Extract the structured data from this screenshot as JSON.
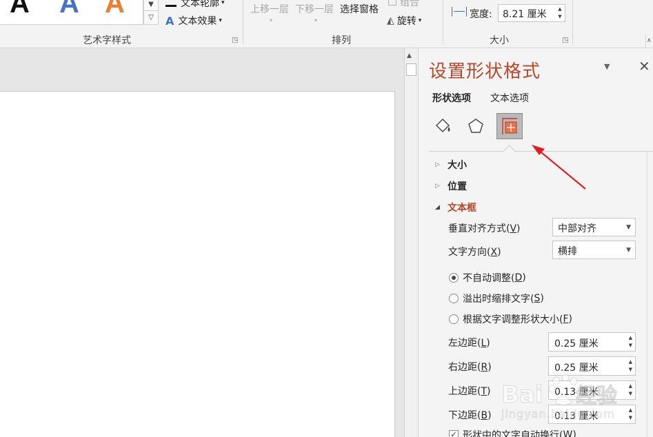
{
  "ribbon": {
    "wordart_gallery": [
      "A",
      "A",
      "A"
    ],
    "wordart_colors": [
      "#1a1a1a",
      "#4472c4",
      "#ed7d31"
    ],
    "text_outline_label": "文本轮廓",
    "text_effects_label": "文本效果",
    "group_wordart": "艺术字样式",
    "bring_forward": "上移一层",
    "send_backward": "下移一层",
    "selection_pane": "选择窗格",
    "group_label": "组合",
    "rotate": "旋转",
    "group_arrange": "排列",
    "width_label": "宽度:",
    "width_value": "8.21 厘米",
    "group_size": "大小"
  },
  "pane": {
    "title": "设置形状格式",
    "tabs": [
      "形状选项",
      "文本选项"
    ],
    "active_tab": "形状选项",
    "icons": [
      "fill-line-icon",
      "effects-pentagon-icon",
      "size-properties-icon"
    ],
    "selected_icon": "size-properties-icon",
    "sections": {
      "size": "大小",
      "position": "位置",
      "textbox": "文本框"
    },
    "vertical_align": {
      "label": "垂直对齐方式(",
      "key": "V",
      "value": "中部对齐"
    },
    "text_direction": {
      "label": "文字方向(",
      "key": "X",
      "value": "横排"
    },
    "autofit": [
      {
        "label": "不自动调整(",
        "key": "D",
        "checked": true
      },
      {
        "label": "溢出时缩排文字(",
        "key": "S",
        "checked": false
      },
      {
        "label": "根据文字调整形状大小(",
        "key": "F",
        "checked": false
      }
    ],
    "margins": [
      {
        "label": "左边距(",
        "key": "L",
        "value": "0.25 厘米"
      },
      {
        "label": "右边距(",
        "key": "R",
        "value": "0.25 厘米"
      },
      {
        "label": "上边距(",
        "key": "T",
        "value": "0.13 厘米"
      },
      {
        "label": "下边距(",
        "key": "B",
        "value": "0.13 厘米"
      }
    ],
    "wrap_text": {
      "label": "形状中的文字自动换行(",
      "key": "W",
      "checked": true
    }
  },
  "watermark": {
    "logo": "Baidu经验",
    "url": "jingyan.baidu.com"
  },
  "colors": {
    "accent": "#b7472a",
    "annotation_arrow": "#e02020"
  }
}
